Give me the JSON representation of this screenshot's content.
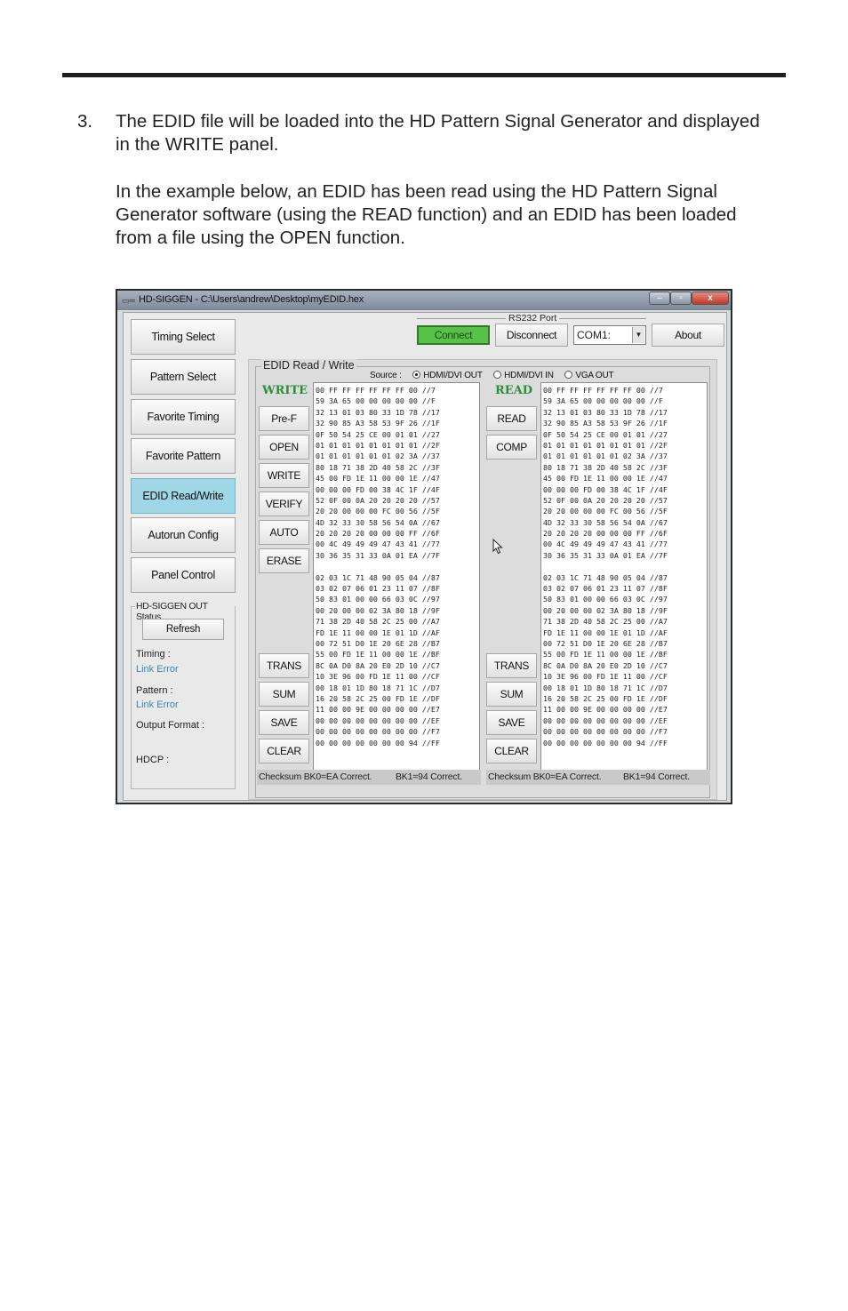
{
  "doc": {
    "step_number": "3.",
    "step_text": "The EDID file will be loaded into the HD Pattern Signal Generator and displayed in the WRITE panel.",
    "example_text": "In the example below, an EDID has been read using the HD Pattern Signal Generator software (using the READ function) and an EDID has been loaded from a file using the OPEN function."
  },
  "window": {
    "title": "HD-SIGGEN  - C:\\Users\\andrew\\Desktop\\myEDID.hex",
    "min_label": "–",
    "max_label": "▫",
    "close_label": "x"
  },
  "nav": {
    "timing_select": "Timing Select",
    "pattern_select": "Pattern Select",
    "favorite_timing": "Favorite Timing",
    "favorite_pattern": "Favorite Pattern",
    "edid_read_write": "EDID Read/Write",
    "autorun_config": "Autorun Config",
    "panel_control": "Panel Control"
  },
  "status": {
    "group_title": "HD-SIGGEN OUT Status",
    "refresh": "Refresh",
    "timing_label": "Timing :",
    "timing_value": "Link Error",
    "pattern_label": "Pattern :",
    "pattern_value": "Link Error",
    "output_format_label": "Output Format :",
    "hdcp_label": "HDCP :"
  },
  "rs232": {
    "group_title": "RS232 Port",
    "connect": "Connect",
    "disconnect": "Disconnect",
    "com_port": "COM1:",
    "about": "About"
  },
  "edid": {
    "group_title": "EDID Read / Write",
    "source_label": "Source :",
    "source_options": [
      "HDMI/DVI  OUT",
      "HDMI/DVI  IN",
      "VGA  OUT"
    ],
    "selected_source": "HDMI/DVI  OUT",
    "write_label": "WRITE",
    "read_label": "READ",
    "write_buttons": {
      "pref": "Pre-F",
      "open": "OPEN",
      "write": "WRITE",
      "verify": "VERIFY",
      "auto": "AUTO",
      "erase": "ERASE",
      "trans": "TRANS",
      "sum": "SUM",
      "save": "SAVE",
      "clear": "CLEAR"
    },
    "read_buttons": {
      "read": "READ",
      "comp": "COMP",
      "trans": "TRANS",
      "sum": "SUM",
      "save": "SAVE",
      "clear": "CLEAR"
    },
    "block0": [
      "00 FF FF FF FF FF FF 00 //7",
      "59 3A 65 00 00 00 00 00 //F",
      "32 13 01 03 80 33 1D 78 //17",
      "32 90 85 A3 58 53 9F 26 //1F",
      "0F 50 54 25 CE 00 01 01 //27",
      "01 01 01 01 01 01 01 01 //2F",
      "01 01 01 01 01 01 02 3A //37",
      "80 18 71 38 2D 40 58 2C //3F",
      "45 00 FD 1E 11 00 00 1E //47",
      "00 00 00 FD 00 38 4C 1F //4F",
      "52 0F 00 0A 20 20 20 20 //57",
      "20 20 00 00 00 FC 00 56 //5F",
      "4D 32 33 30 58 56 54 0A //67",
      "20 20 20 20 00 00 00 FF //6F",
      "00 4C 49 49 49 47 43 41 //77",
      "30 36 35 31 33 0A 01 EA //7F"
    ],
    "block1": [
      "02 03 1C 71 48 90 05 04 //87",
      "03 02 07 06 01 23 11 07 //8F",
      "50 83 01 00 00 66 03 0C //97",
      "00 20 00 00 02 3A 80 18 //9F",
      "71 38 2D 40 58 2C 25 00 //A7",
      "FD 1E 11 00 00 1E 01 1D //AF",
      "00 72 51 D0 1E 20 6E 28 //B7",
      "55 00 FD 1E 11 00 00 1E //BF",
      "8C 0A D0 8A 20 E0 2D 10 //C7",
      "10 3E 96 00 FD 1E 11 00 //CF",
      "00 18 01 1D 80 18 71 1C //D7",
      "16 20 58 2C 25 00 FD 1E //DF",
      "11 00 00 9E 00 00 00 00 //E7",
      "00 00 00 00 00 00 00 00 //EF",
      "00 00 00 00 00 00 00 00 //F7",
      "00 00 00 00 00 00 00 94 //FF"
    ],
    "checksum_bk0": "Checksum BK0=EA Correct.",
    "checksum_bk1": "BK1=94 Correct."
  }
}
